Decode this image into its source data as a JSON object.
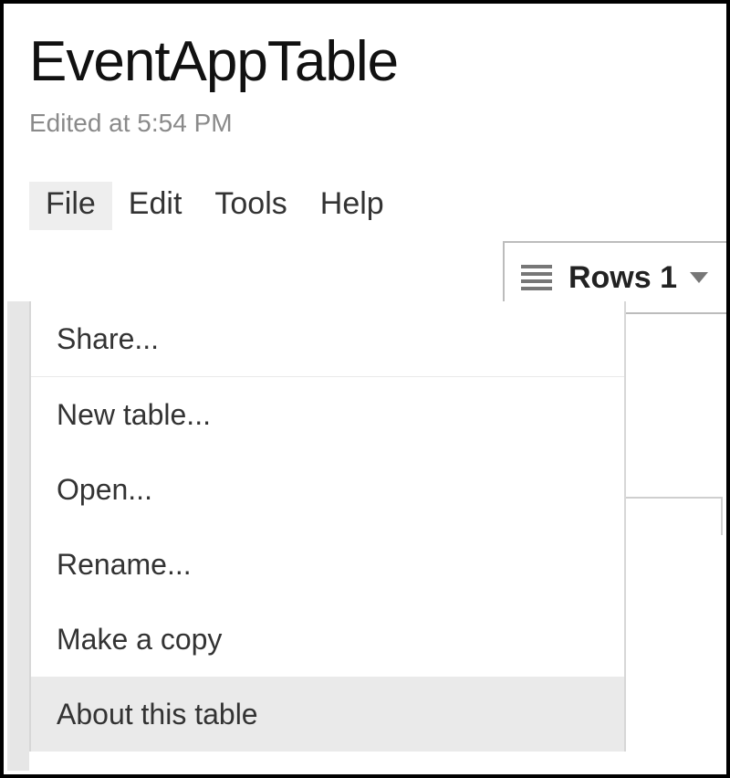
{
  "header": {
    "title": "EventAppTable",
    "edited_status": "Edited at 5:54 PM"
  },
  "menubar": {
    "items": [
      {
        "label": "File",
        "active": true
      },
      {
        "label": "Edit",
        "active": false
      },
      {
        "label": "Tools",
        "active": false
      },
      {
        "label": "Help",
        "active": false
      }
    ]
  },
  "rows_control": {
    "label": "Rows 1"
  },
  "file_menu": {
    "items": [
      {
        "label": "Share...",
        "hovered": false
      },
      {
        "label": "New table...",
        "hovered": false
      },
      {
        "label": "Open...",
        "hovered": false
      },
      {
        "label": "Rename...",
        "hovered": false
      },
      {
        "label": "Make a copy",
        "hovered": false
      },
      {
        "label": "About this table",
        "hovered": true
      }
    ]
  }
}
